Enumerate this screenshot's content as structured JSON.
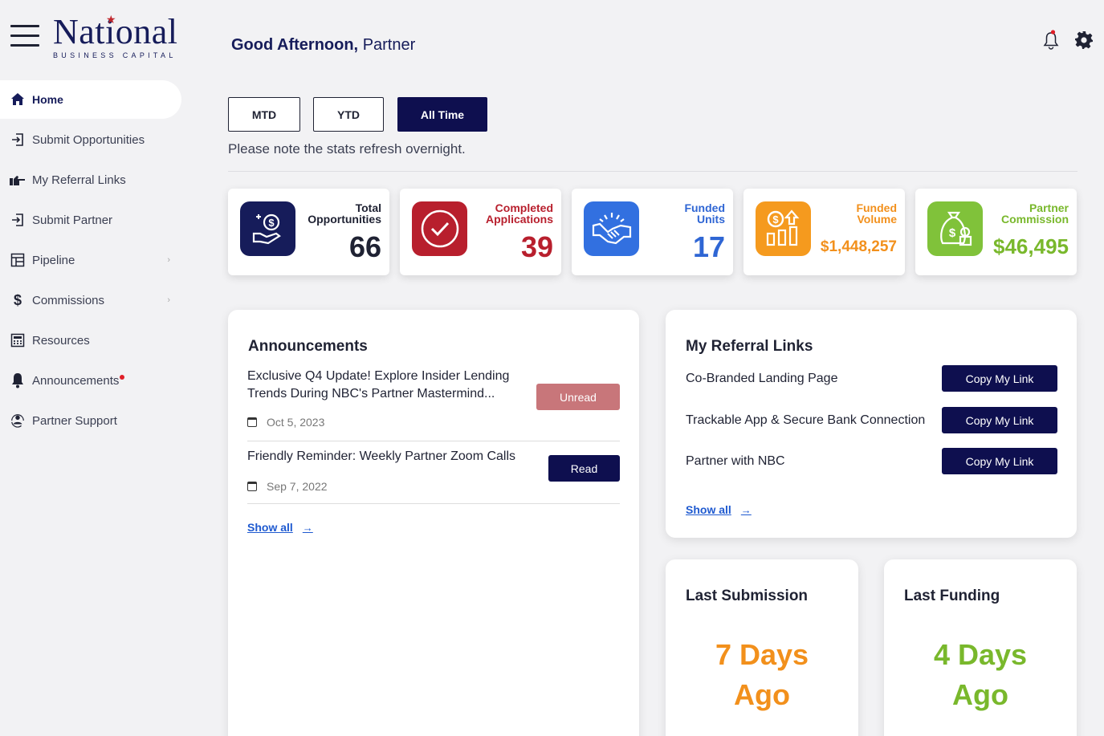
{
  "brand": {
    "name": "National",
    "subtitle": "BUSINESS CAPITAL"
  },
  "sidebar": {
    "items": [
      {
        "label": "Home",
        "icon": "home-icon",
        "active": true
      },
      {
        "label": "Submit Opportunities",
        "icon": "submit-icon"
      },
      {
        "label": "My Referral Links",
        "icon": "pointing-hand-icon"
      },
      {
        "label": "Submit Partner",
        "icon": "submit-icon"
      },
      {
        "label": "Pipeline",
        "icon": "pipeline-icon",
        "chevron": "›"
      },
      {
        "label": "Commissions",
        "icon": "dollar-icon",
        "chevron": "›"
      },
      {
        "label": "Resources",
        "icon": "calculator-icon"
      },
      {
        "label": "Announcements",
        "icon": "bell-icon",
        "badge": true
      },
      {
        "label": "Partner Support",
        "icon": "support-icon"
      }
    ]
  },
  "header": {
    "greeting_bold": "Good Afternoon,",
    "greeting_name": "Partner"
  },
  "filters": {
    "options": [
      "MTD",
      "YTD",
      "All Time"
    ],
    "selected": "All Time",
    "note": "Please note the stats refresh overnight."
  },
  "stats": [
    {
      "label_line1": "Total",
      "label_line2": "Opportunities",
      "value": "66",
      "color": "#1f2233",
      "icon_bg": "#161c5a",
      "icon": "hand-dollar-icon"
    },
    {
      "label_line1": "Completed",
      "label_line2": "Applications",
      "value": "39",
      "color": "#b81f2d",
      "icon_bg": "#b81f2d",
      "icon": "check-circle-icon"
    },
    {
      "label_line1": "Funded",
      "label_line2": "Units",
      "value": "17",
      "color": "#2f66d4",
      "icon_bg": "#3270e0",
      "icon": "handshake-icon"
    },
    {
      "label_line1": "Funded",
      "label_line2": "Volume",
      "value": "$1,448,257",
      "color": "#f2901c",
      "icon_bg": "#f59a1e",
      "icon": "growth-chart-icon"
    },
    {
      "label_line1": "Partner",
      "label_line2": "Commission",
      "value": "$46,495",
      "color": "#79b82c",
      "icon_bg": "#80c23a",
      "icon": "money-bag-icon"
    }
  ],
  "announcements": {
    "title": "Announcements",
    "items": [
      {
        "title": "Exclusive Q4 Update! Explore Insider Lending Trends During NBC's Partner Mastermind...",
        "date": "Oct 5, 2023",
        "status": "Unread"
      },
      {
        "title": "Friendly Reminder: Weekly Partner Zoom Calls",
        "date": "Sep 7, 2022",
        "status": "Read"
      }
    ],
    "show_all": "Show all",
    "arrow": "→"
  },
  "referral_links": {
    "title": "My Referral Links",
    "items": [
      {
        "label": "Co-Branded Landing Page",
        "button": "Copy My Link"
      },
      {
        "label": "Trackable App & Secure Bank Connection",
        "button": "Copy My Link"
      },
      {
        "label": "Partner with NBC",
        "button": "Copy My Link"
      }
    ],
    "show_all": "Show all",
    "arrow": "→"
  },
  "last_submission": {
    "title": "Last Submission",
    "line1": "7 Days",
    "line2": "Ago",
    "color": "#f2901c"
  },
  "last_funding": {
    "title": "Last Funding",
    "line1": "4 Days",
    "line2": "Ago",
    "color": "#79b82c"
  }
}
